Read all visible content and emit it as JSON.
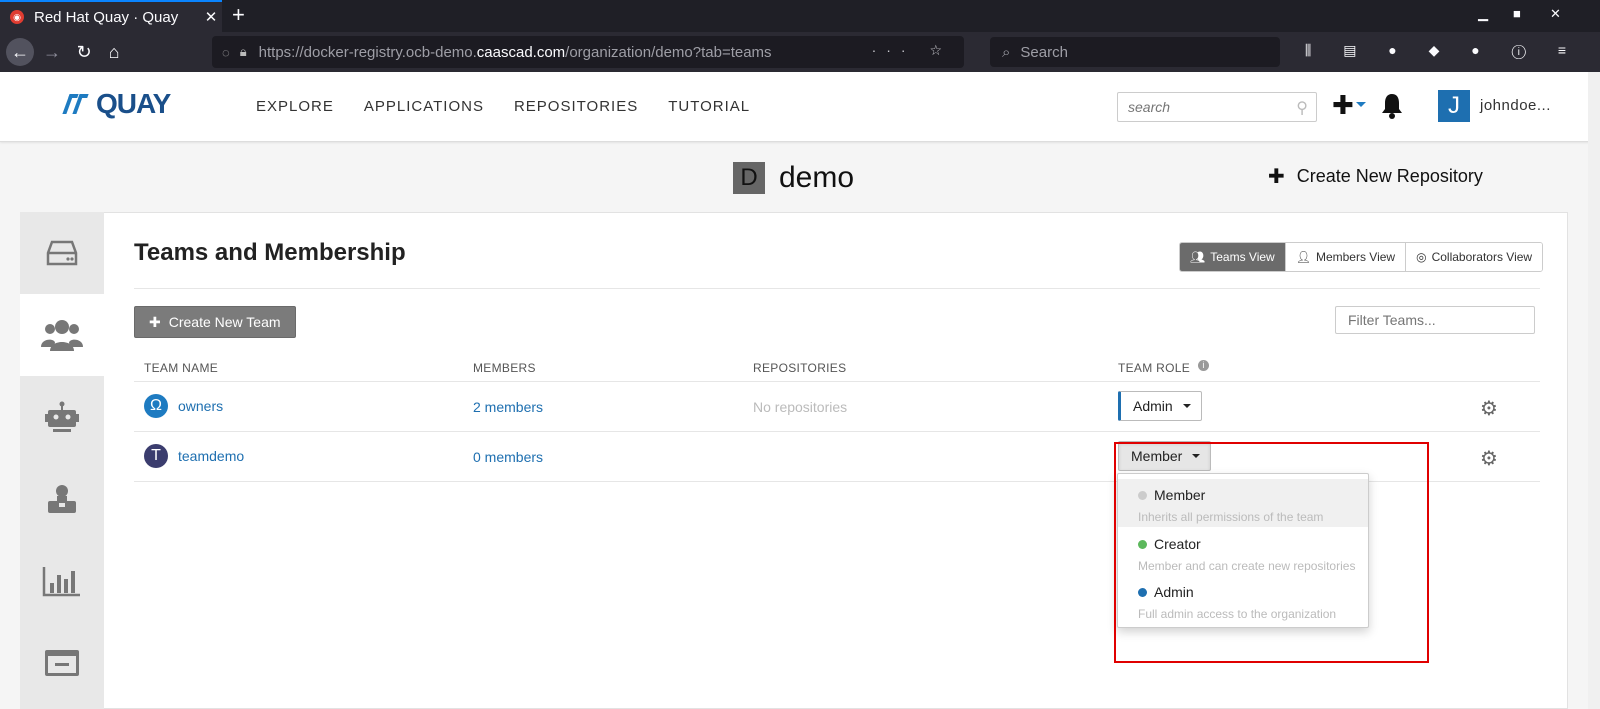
{
  "browser": {
    "tab_title": "Red Hat Quay · Quay",
    "tab_close": "✕",
    "new_tab": "+",
    "url_prefix": "https://docker-registry.ocb-demo.",
    "url_domain": "caascad.com",
    "url_suffix": "/organization/demo?tab=teams",
    "search_placeholder": "Search"
  },
  "header": {
    "logo_text": "QUAY",
    "nav": [
      "EXPLORE",
      "APPLICATIONS",
      "REPOSITORIES",
      "TUTORIAL"
    ],
    "search_placeholder": "search",
    "avatar_letter": "J",
    "username": "johndoe..."
  },
  "org": {
    "avatar_letter": "D",
    "name": "demo",
    "create_repo_label": "Create New Repository"
  },
  "teams_section": {
    "title": "Teams and Membership",
    "views": [
      {
        "label": "Teams View",
        "active": true,
        "icon": "users-icon"
      },
      {
        "label": "Members View",
        "active": false,
        "icon": "user-icon"
      },
      {
        "label": "Collaborators View",
        "active": false,
        "icon": "user-circle-icon"
      }
    ],
    "create_team_label": "Create New Team",
    "filter_placeholder": "Filter Teams...",
    "columns": [
      "TEAM NAME",
      "MEMBERS",
      "REPOSITORIES",
      "TEAM ROLE"
    ],
    "teams": [
      {
        "icon_glyph": "Ω",
        "icon_color": "#1e7bc1",
        "name": "owners",
        "members": "2 members",
        "repositories": "No repositories",
        "role": "Admin"
      },
      {
        "icon_glyph": "T",
        "icon_color": "#3b3d6e",
        "name": "teamdemo",
        "members": "0 members",
        "repositories": "",
        "role": "Member"
      }
    ]
  },
  "role_dropdown": {
    "options": [
      {
        "label": "Member",
        "description": "Inherits all permissions of the team",
        "color": "#cccccc"
      },
      {
        "label": "Creator",
        "description": "Member and can create new repositories",
        "color": "#5cb85c"
      },
      {
        "label": "Admin",
        "description": "Full admin access to the organization",
        "color": "#1e6fb0"
      }
    ]
  },
  "colors": {
    "accent": "#1e6fb0",
    "highlight": "#e00000"
  }
}
